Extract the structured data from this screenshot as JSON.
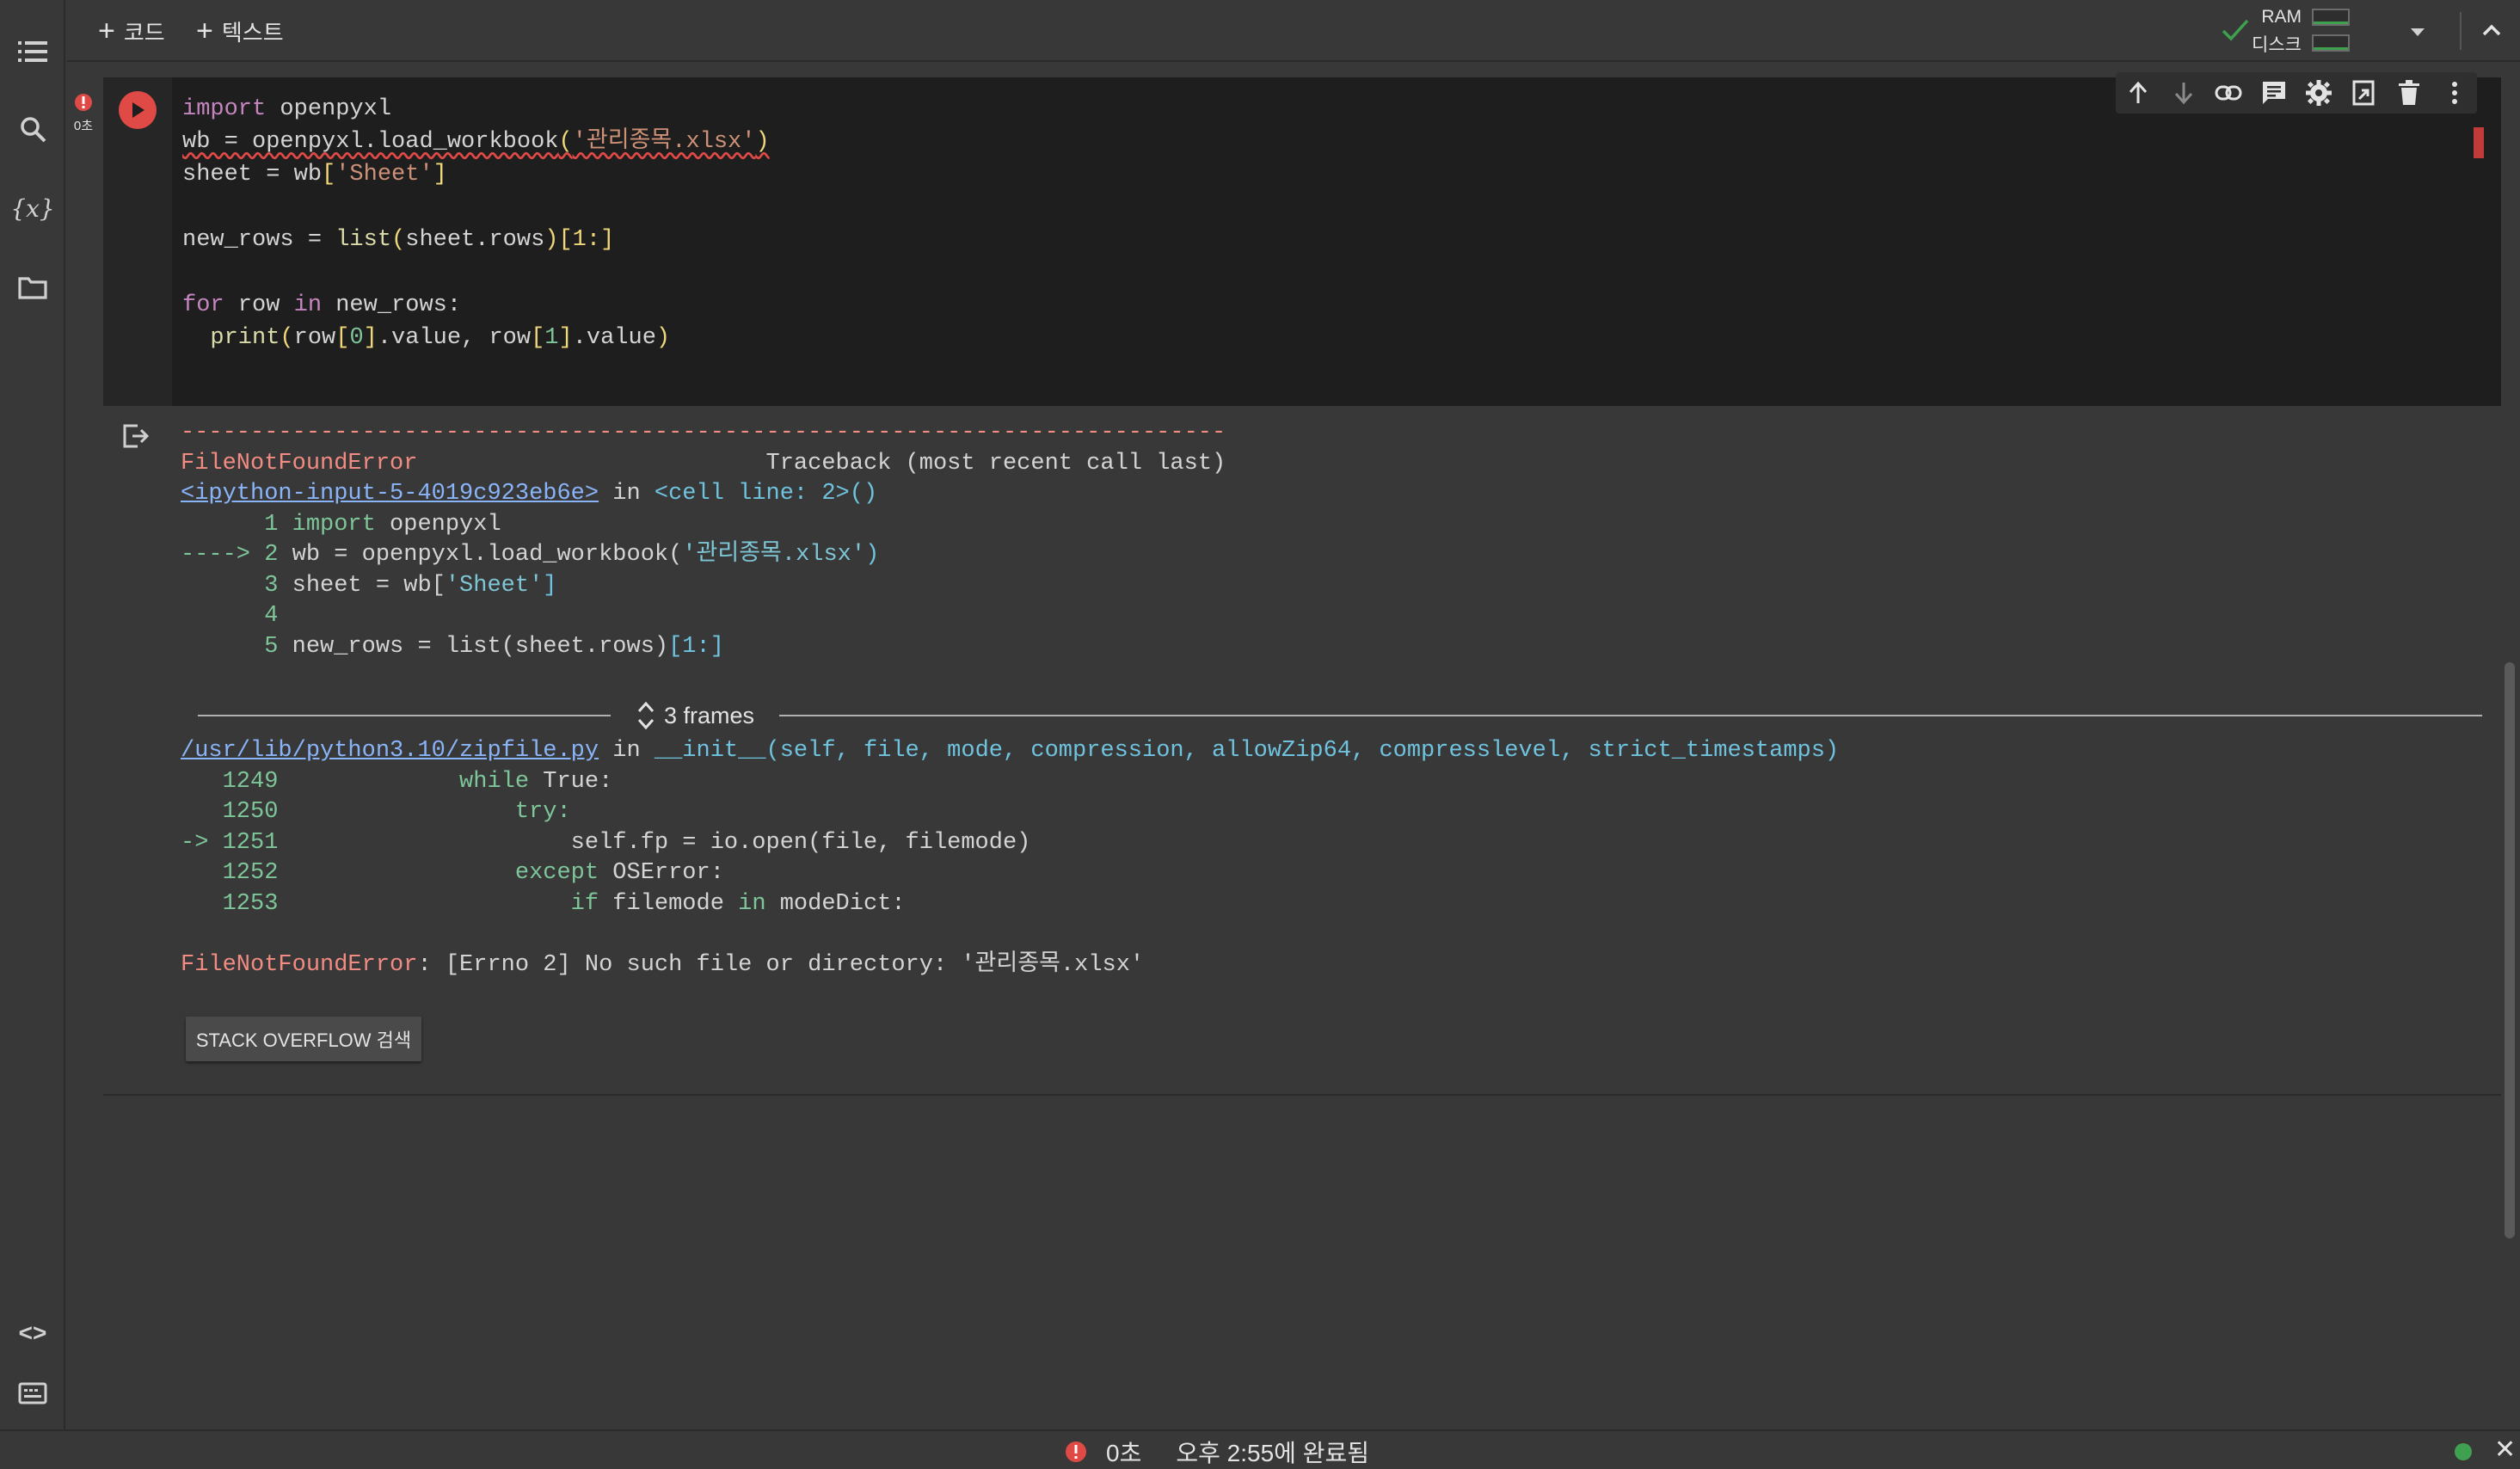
{
  "toolbar": {
    "add_code_label": "코드",
    "add_text_label": "텍스트",
    "ram_label": "RAM",
    "disk_label": "디스크"
  },
  "cell": {
    "exec_time": "0초",
    "code": {
      "line1_kw": "import",
      "line1_rest": " openpyxl",
      "line2_a": "wb = openpyxl.load_workbook",
      "line2_open": "(",
      "line2_str": "'관리종목.xlsx'",
      "line2_close": ")",
      "line3_a": "sheet = wb",
      "line3_open": "[",
      "line3_str": "'Sheet'",
      "line3_close": "]",
      "line5_a": "new_rows = ",
      "line5_fn": "list",
      "line5_open": "(",
      "line5_b": "sheet.rows",
      "line5_close": ")",
      "line5_slice": "[1:]",
      "line7_kw1": "for",
      "line7_a": " row ",
      "line7_kw2": "in",
      "line7_b": " new_rows:",
      "line8_fn": "  print",
      "line8_open": "(",
      "line8_a": "row",
      "line8_b1": "[",
      "line8_n0": "0",
      "line8_b2": "]",
      "line8_c": ".value, row",
      "line8_b3": "[",
      "line8_n1": "1",
      "line8_b4": "]",
      "line8_d": ".value",
      "line8_close": ")"
    }
  },
  "output": {
    "dashes": "---------------------------------------------------------------------------",
    "err_name": "FileNotFoundError",
    "traceback_header": "                         Traceback (most recent call last)",
    "input_link": "<ipython-input-5-4019c923eb6e>",
    "input_in": " in ",
    "input_loc": "<cell line: 2>()",
    "tb1_num": "      1 ",
    "tb1_kw": "import",
    "tb1_rest": " openpyxl",
    "tb2_arrow": "----> 2 ",
    "tb2_a": "wb = openpyxl.load_workbook(",
    "tb2_str": "'관리종목.xlsx'",
    "tb2_close": ")",
    "tb3_num": "      3 ",
    "tb3_a": "sheet = wb[",
    "tb3_str": "'Sheet'",
    "tb3_close": "]",
    "tb4_num": "      4",
    "tb5_num": "      5 ",
    "tb5_a": "new_rows = list(sheet.rows)",
    "tb5_slice": "[1:]",
    "frames_label": "3 frames",
    "zip_link": "/usr/lib/python3.10/zipfile.py",
    "zip_in": " in ",
    "zip_sig": "__init__(self, file, mode, compression, allowZip64, compresslevel, strict_timestamps)",
    "z1_num": "   1249 ",
    "z1_kw": "            while",
    "z1_rest": " True:",
    "z2_num": "   1250 ",
    "z2_kw": "                try:",
    "z3_arrow": "-> 1251 ",
    "z3_rest": "                    self.fp = io.open(file, filemode)",
    "z4_num": "   1252 ",
    "z4_kw": "                except",
    "z4_rest": " OSError:",
    "z5_num": "   1253 ",
    "z5_kw": "                    if",
    "z5_a": " filemode ",
    "z5_kw2": "in",
    "z5_b": " modeDict:",
    "final_err": "FileNotFoundError",
    "final_msg": ": [Errno 2] No such file or directory: '관리종목.xlsx'",
    "so_button": "STACK OVERFLOW 검색"
  },
  "statusbar": {
    "time": "0초",
    "completed": "오후 2:55에 완료됨"
  },
  "colors": {
    "accent_red": "#e04a46",
    "status_green": "#3fa14f"
  }
}
